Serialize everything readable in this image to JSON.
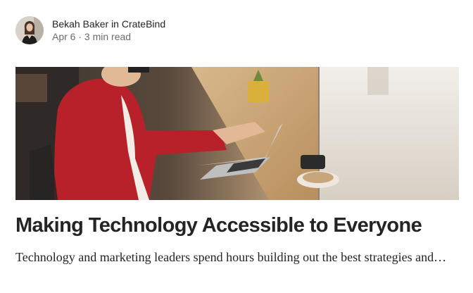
{
  "post": {
    "author": "Bekah Baker",
    "in_word": "in",
    "publication": "CrateBind",
    "date": "Apr 6",
    "separator": "·",
    "read_time": "3 min read",
    "title": "Making Technology Accessible to Everyone",
    "excerpt": "Technology and marketing leaders spend hours building out the best strategies and…"
  }
}
